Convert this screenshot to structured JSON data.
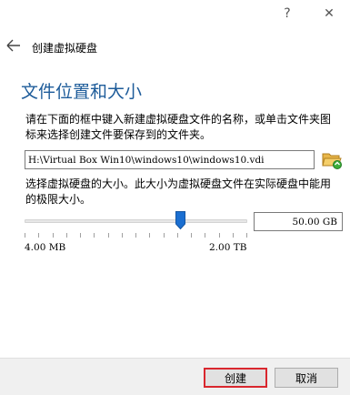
{
  "titlebar": {
    "help": "?",
    "close": "✕"
  },
  "header": {
    "title": "创建虚拟硬盘"
  },
  "section": {
    "title": "文件位置和大小"
  },
  "description": "请在下面的框中键入新建虚拟硬盘文件的名称，或单击文件夹图标来选择创建文件要保存到的文件夹。",
  "file": {
    "path": "H:\\Virtual Box Win10\\windows10\\windows10.vdi"
  },
  "size": {
    "description": "选择虚拟硬盘的大小。此大小为虚拟硬盘文件在实际硬盘中能用的极限大小。",
    "value": "50.00 GB",
    "min_label": "4.00 MB",
    "max_label": "2.00 TB",
    "slider_fraction": 0.7
  },
  "buttons": {
    "create": "创建",
    "cancel": "取消"
  },
  "colors": {
    "section_title": "#1e5c9a",
    "accent_border": "#d9272e",
    "slider_thumb": "#1b6fd1"
  },
  "icons": {
    "back": "left-arrow-icon",
    "folder": "folder-open-icon"
  }
}
